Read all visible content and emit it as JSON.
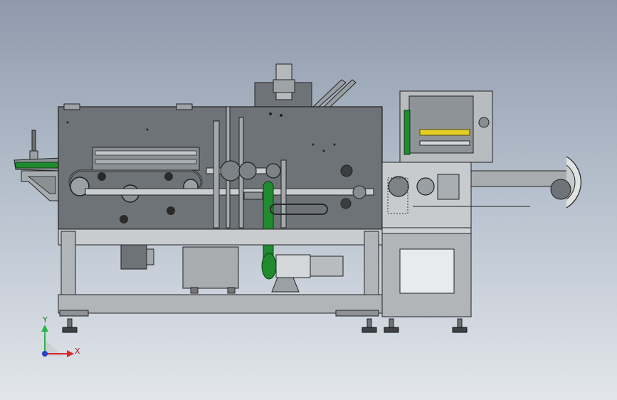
{
  "triad": {
    "y_label": "Y",
    "x_label": "X",
    "y_color": "#2db34a",
    "x_color": "#d9262b",
    "z_color": "#2740c8"
  },
  "colors": {
    "frame": "#5f6366",
    "frame_light": "#b2b5b8",
    "panel": "#6e7377",
    "belt": "#1f8a2e",
    "motor": "#8a8f93",
    "foot": "#3e4245"
  }
}
